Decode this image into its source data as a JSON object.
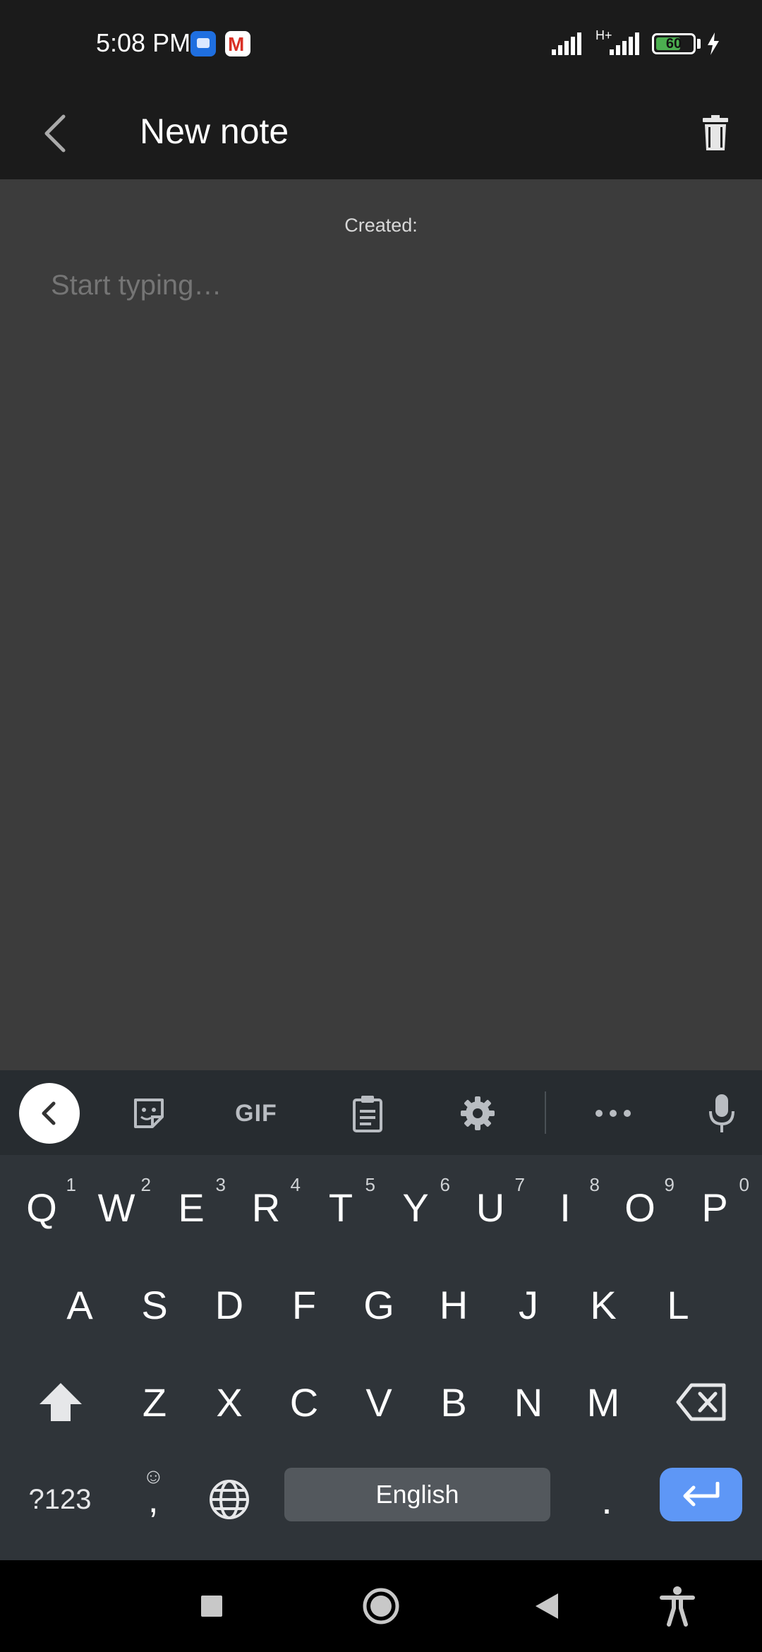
{
  "status_bar": {
    "time": "5:08 PM",
    "network": "H+",
    "battery_level": "60",
    "icons": [
      "messages-icon",
      "gmail-icon",
      "signal-icon",
      "signal-icon",
      "battery-icon",
      "charging-icon"
    ]
  },
  "app_bar": {
    "title": "New note",
    "back_icon": "back-arrow-icon",
    "delete_icon": "trash-icon"
  },
  "note": {
    "created_label": "Created:",
    "placeholder": "Start typing…",
    "value": ""
  },
  "keyboard": {
    "toolbar": [
      "collapse-icon",
      "sticker-icon",
      "gif",
      "clipboard-icon",
      "settings-icon",
      "more-icon",
      "mic-icon"
    ],
    "gif_label": "GIF",
    "row1": [
      {
        "key": "Q",
        "hint": "1"
      },
      {
        "key": "W",
        "hint": "2"
      },
      {
        "key": "E",
        "hint": "3"
      },
      {
        "key": "R",
        "hint": "4"
      },
      {
        "key": "T",
        "hint": "5"
      },
      {
        "key": "Y",
        "hint": "6"
      },
      {
        "key": "U",
        "hint": "7"
      },
      {
        "key": "I",
        "hint": "8"
      },
      {
        "key": "O",
        "hint": "9"
      },
      {
        "key": "P",
        "hint": "0"
      }
    ],
    "row2": [
      "A",
      "S",
      "D",
      "F",
      "G",
      "H",
      "J",
      "K",
      "L"
    ],
    "row3": [
      "Z",
      "X",
      "C",
      "V",
      "B",
      "N",
      "M"
    ],
    "symbols_label": "?123",
    "emoji_top": "☺",
    "comma_label": ",",
    "space_label": "English",
    "period_label": "."
  },
  "colors": {
    "enter_key": "#5e97f6",
    "note_background": "#3c3c3c",
    "keyboard_background": "#2f3439"
  }
}
